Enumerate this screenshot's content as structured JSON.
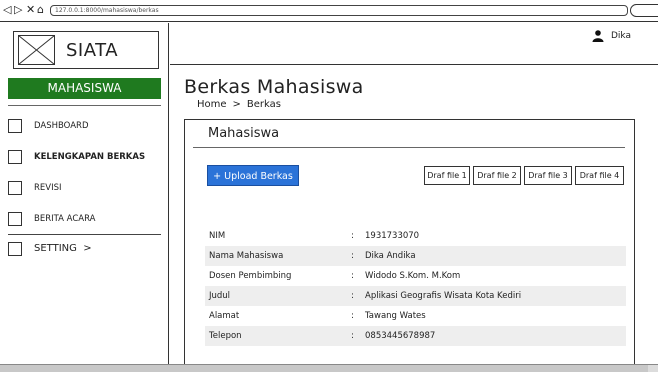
{
  "browser": {
    "back_icon": "back-arrow-icon",
    "forward_icon": "forward-arrow-icon",
    "close_icon": "close-icon",
    "home_icon": "home-icon",
    "url": "127.0.0.1:8000/mahasiswa/berkas"
  },
  "sidebar": {
    "logo_text": "SIATA",
    "role": "MAHASISWA",
    "role_color": "#1f7a1f",
    "items": [
      {
        "label": "DASHBOARD"
      },
      {
        "label": "KELENGKAPAN BERKAS"
      },
      {
        "label": "REVISI"
      },
      {
        "label": "BERITA ACARA"
      },
      {
        "label": "SETTING"
      }
    ],
    "setting_chevron": ">"
  },
  "header": {
    "user_icon": "user-icon",
    "user_name": "Dika"
  },
  "main": {
    "title": "Berkas Mahasiswa",
    "breadcrumb": {
      "home": "Home",
      "separator": ">",
      "current": "Berkas"
    },
    "card": {
      "title": "Mahasiswa",
      "upload_label": "+ Upload Berkas",
      "upload_color": "#2b73d8",
      "draf_buttons": [
        "Draf file 1",
        "Draf file 2",
        "Draf file 3",
        "Draf file 4"
      ],
      "info": [
        {
          "label": "NIM",
          "value": "1931733070"
        },
        {
          "label": "Nama Mahasiswa",
          "value": "Dika Andika"
        },
        {
          "label": "Dosen Pembimbing",
          "value": "Widodo S.Kom. M.Kom"
        },
        {
          "label": "Judul",
          "value": "Aplikasi Geografis Wisata Kota Kediri"
        },
        {
          "label": "Alamat",
          "value": "Tawang Wates"
        },
        {
          "label": "Telepon",
          "value": "0853445678987"
        }
      ],
      "colon": ":"
    }
  }
}
